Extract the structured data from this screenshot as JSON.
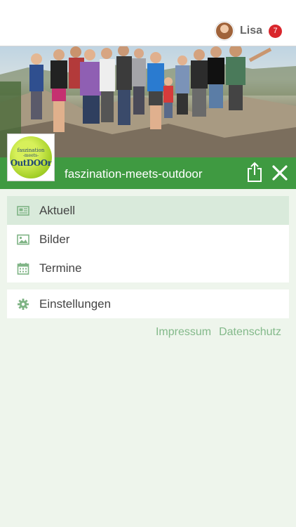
{
  "header": {
    "user_name": "Lisa",
    "notification_count": "7"
  },
  "group": {
    "name": "faszination-meets-outdoor",
    "logo": {
      "line1": "faszination",
      "line2": "-meets-",
      "line3": "OutDOOr"
    }
  },
  "menu": {
    "items": [
      {
        "label": "Aktuell",
        "icon": "newspaper-icon",
        "active": true
      },
      {
        "label": "Bilder",
        "icon": "image-icon",
        "active": false
      },
      {
        "label": "Termine",
        "icon": "calendar-icon",
        "active": false
      }
    ],
    "settings_label": "Einstellungen"
  },
  "footer": {
    "impressum": "Impressum",
    "datenschutz": "Datenschutz"
  },
  "colors": {
    "primary_green": "#3f9a41",
    "background": "#eef5ec",
    "active_item": "#d9eadb",
    "badge_red": "#d9262c",
    "link_green": "#83b98a"
  }
}
